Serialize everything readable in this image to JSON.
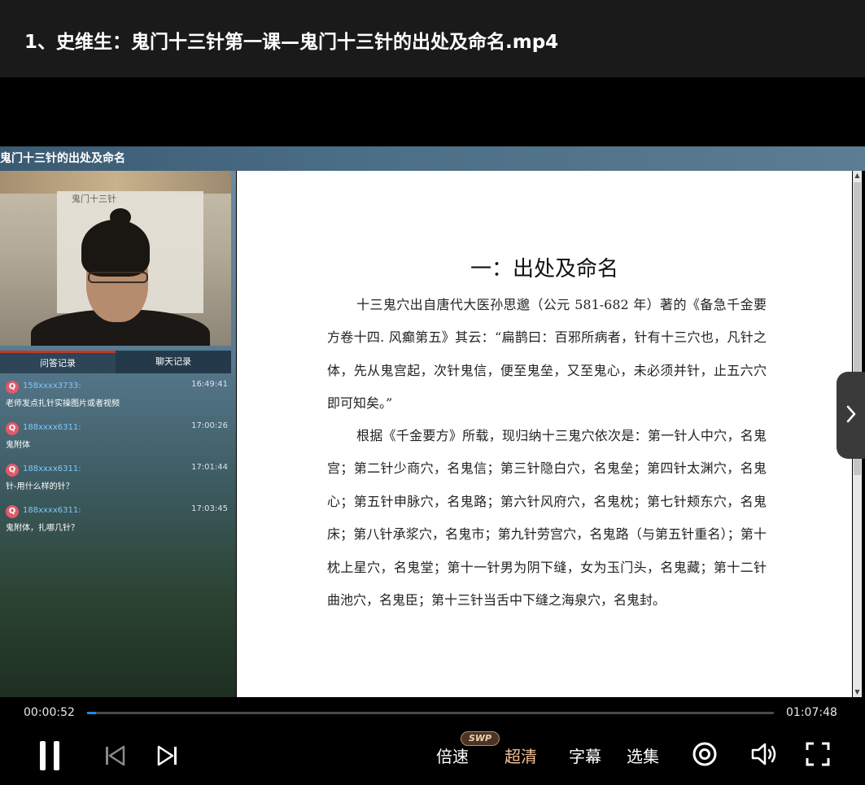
{
  "window": {
    "title": "1、史维生：鬼门十三针第一课—鬼门十三针的出处及命名.mp4"
  },
  "slide": {
    "course_title": "鬼门十三针的出处及命名"
  },
  "webcam": {
    "paper_text": "鬼门十三针"
  },
  "chat_panel": {
    "tabs": [
      {
        "label": "问答记录",
        "active": true
      },
      {
        "label": "聊天记录",
        "active": false
      }
    ],
    "icon_letter": "Q",
    "messages": [
      {
        "user": "158xxxx3733:",
        "time": "16:49:41",
        "text": "老师发点扎针实操图片或者视频"
      },
      {
        "user": "188xxxx6311:",
        "time": "17:00:26",
        "text": "鬼附体"
      },
      {
        "user": "188xxxx6311:",
        "time": "17:01:44",
        "text": "针-用什么样的针？"
      },
      {
        "user": "188xxxx6311:",
        "time": "17:03:45",
        "text": "鬼附体，扎哪几针？"
      }
    ]
  },
  "document": {
    "heading": "一：出处及命名",
    "paragraphs": [
      "十三鬼穴出自唐代大医孙思邈（公元 581-682 年）著的《备急千金要方卷十四. 风癫第五》其云：“扁鹊曰：百邪所病者，针有十三穴也，凡针之体，先从鬼宫起，次针鬼信，便至鬼垒，又至鬼心，未必须并针，止五六穴即可知矣。”",
      "根据《千金要方》所载，现归纳十三鬼穴依次是：第一针人中穴，名鬼宫；第二针少商穴，名鬼信；第三针隐白穴，名鬼垒；第四针太渊穴，名鬼心；第五针申脉穴，名鬼路；第六针风府穴，名鬼枕；第七针颊东穴，名鬼床；第八针承浆穴，名鬼市；第九针劳宫穴，名鬼路（与第五针重名）；第十枕上星穴，名鬼堂；第十一针男为阴下缝，女为玉门头，名鬼藏；第十二针曲池穴，名鬼臣；第十三针当舌中下缝之海泉穴，名鬼封。"
    ]
  },
  "player": {
    "current_time": "00:00:52",
    "total_time": "01:07:48",
    "progress_fraction": 0.0128,
    "speed_label": "倍速",
    "swp_badge": "SWP",
    "quality_label": "超清",
    "subtitle_label": "字幕",
    "episodes_label": "选集",
    "colors": {
      "progress": "#1e88e5",
      "quality": "#f2c29a"
    }
  }
}
